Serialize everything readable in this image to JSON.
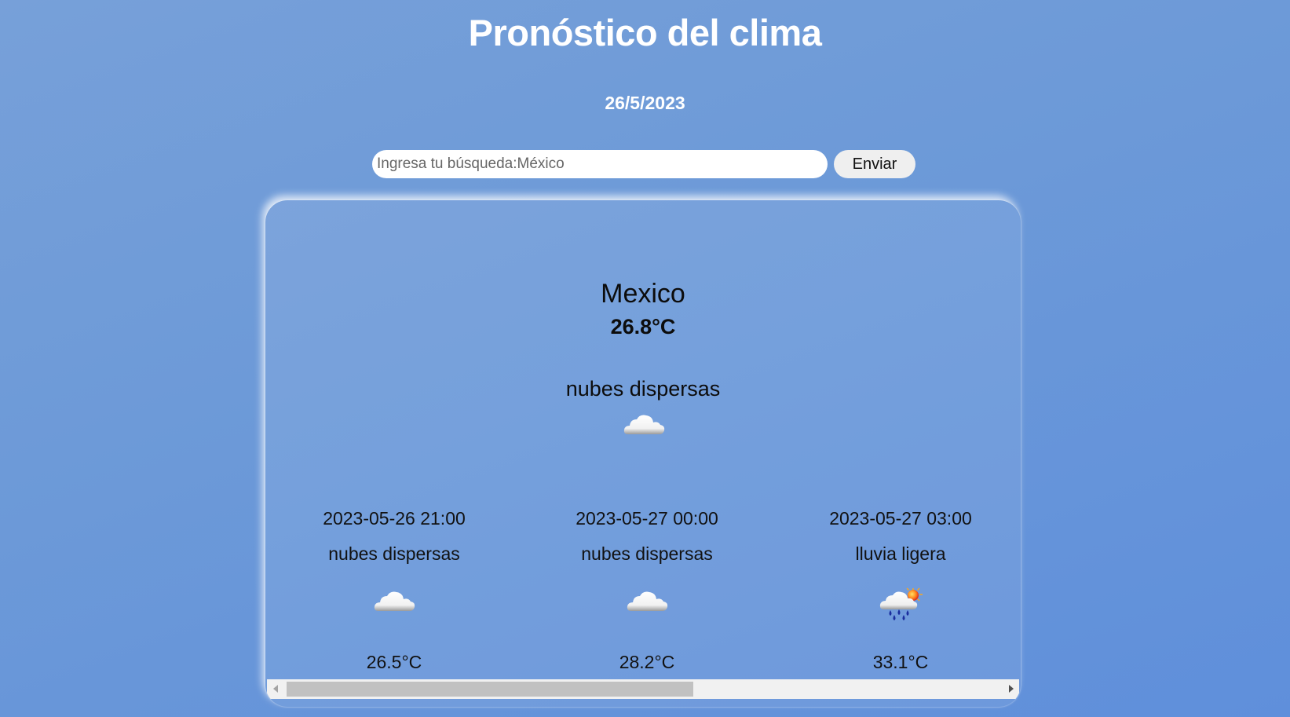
{
  "header": {
    "title": "Pronóstico del clima",
    "date": "26/5/2023"
  },
  "search": {
    "placeholder": "Ingresa tu búsqueda:México",
    "value": "",
    "button_label": "Enviar"
  },
  "current": {
    "city": "Mexico",
    "temperature": "26.8°C",
    "description": "nubes dispersas",
    "icon": "cloud-icon"
  },
  "forecast": [
    {
      "time": "2023-05-26 21:00",
      "description": "nubes dispersas",
      "temperature": "26.5°C",
      "icon": "cloud-icon"
    },
    {
      "time": "2023-05-27 00:00",
      "description": "nubes dispersas",
      "temperature": "28.2°C",
      "icon": "cloud-icon"
    },
    {
      "time": "2023-05-27 03:00",
      "description": "lluvia ligera",
      "temperature": "33.1°C",
      "icon": "rain-sun-cloud-icon"
    }
  ],
  "scrollbar": {
    "position_fraction": 0.0,
    "visible_fraction": 0.57
  },
  "colors": {
    "background": "#6d9ad8",
    "title_text": "#ffffff",
    "card_text": "#0c0c0c"
  }
}
